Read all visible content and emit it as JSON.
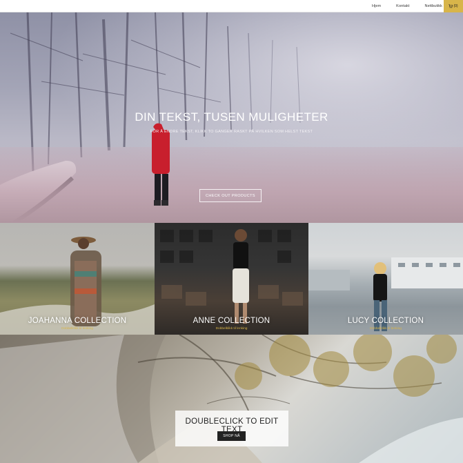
{
  "nav": {
    "links": [
      {
        "label": "Hjem"
      },
      {
        "label": "Kontakt"
      },
      {
        "label": "Nettbutikk"
      }
    ],
    "cart": {
      "icon": "cart-icon",
      "count": "(0)",
      "color": "#d8b54a"
    }
  },
  "hero": {
    "title": "DIN TEKST, TUSEN MULIGHETER",
    "subtitle": "FOR Å ENDRE TEKST, KLIKK TO GANGER RASKT PÅ HVILKEN SOM HELST TEKST",
    "button_label": "CHECK OUT PRODUCTS"
  },
  "collections": [
    {
      "title": "JOAHANNA COLLECTION",
      "subtitle": "Dobbelklikk til lenking"
    },
    {
      "title": "ANNE COLLECTION",
      "subtitle": "Dobbelklikk til lenking"
    },
    {
      "title": "LUCY COLLECTION",
      "subtitle": "Dobbelklikk til lenking"
    }
  ],
  "banner": {
    "title": "DOUBLECLICK TO EDIT TEXT",
    "button_label": "SHOP NÅ"
  },
  "colors": {
    "accent": "#d8b54a",
    "dark": "#222222"
  }
}
